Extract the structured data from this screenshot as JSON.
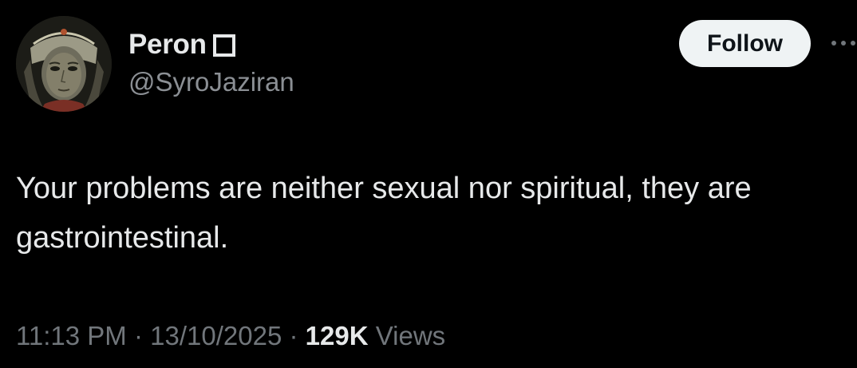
{
  "author": {
    "display_name": "Peron",
    "handle": "@SyroJaziran",
    "avatar_icon": "profile-portrait"
  },
  "actions": {
    "follow_label": "Follow",
    "more_icon": "more-horizontal-icon"
  },
  "tweet": {
    "text": "Your problems are neither sexual nor spiritual, they are gastrointestinal."
  },
  "meta": {
    "time": "11:13 PM",
    "separator": "·",
    "date": "13/10/2025",
    "views_count": "129K",
    "views_label": "Views"
  },
  "colors": {
    "background": "#000000",
    "primary_text": "#e7e9ea",
    "secondary_text": "#71767b",
    "follow_button_bg": "#eff3f4"
  }
}
